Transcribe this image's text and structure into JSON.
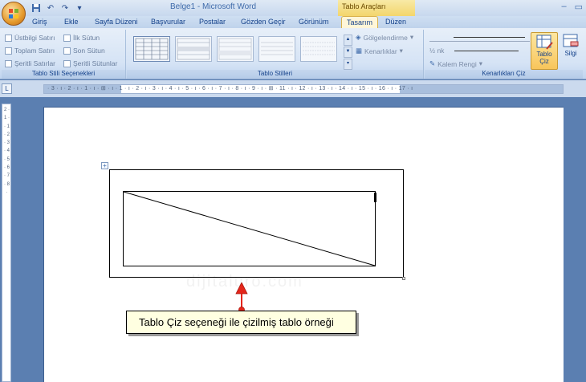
{
  "window": {
    "title": "Belge1 - Microsoft Word",
    "contextual_title": "Tablo Araçları",
    "minimize": "–",
    "restore": "▭"
  },
  "qat": {
    "save_icon": "save-icon",
    "undo_icon": "undo-icon",
    "redo_icon": "redo-icon",
    "customize_icon": "customize-icon"
  },
  "tabs": [
    {
      "label": "Giriş"
    },
    {
      "label": "Ekle"
    },
    {
      "label": "Sayfa Düzeni"
    },
    {
      "label": "Başvurular"
    },
    {
      "label": "Postalar"
    },
    {
      "label": "Gözden Geçir"
    },
    {
      "label": "Görünüm"
    },
    {
      "label": "Tasarım"
    },
    {
      "label": "Düzen"
    }
  ],
  "active_tab": "Tasarım",
  "style_options": {
    "label": "Tablo Stili Seçenekleri",
    "items": [
      {
        "label": "Üstbilgi Satırı"
      },
      {
        "label": "İlk Sütun"
      },
      {
        "label": "Toplam Satırı"
      },
      {
        "label": "Son Sütun"
      },
      {
        "label": "Şeritli Satırlar"
      },
      {
        "label": "Şeritli Sütunlar"
      }
    ]
  },
  "table_styles": {
    "label": "Tablo Stilleri",
    "shading": "Gölgelendirme",
    "borders": "Kenarlıklar"
  },
  "draw_borders": {
    "label": "Kenarlıkları Çiz",
    "pen_weight": "½ nk",
    "pen_color": "Kalem Rengi",
    "draw_table_line1": "Tablo",
    "draw_table_line2": "Çiz",
    "eraser": "Silgi"
  },
  "ruler": {
    "horizontal": "· 3 · ı · 2 · ı · 1 · ı · ⊞ · ı · 1 · ı · 2 · ı · 3 · ı · 4 · ı · 5 · ı · 6 · ı · 7 · ı · 8 · ı · 9 · ı · ⊞ · 11 · ı · 12 · ı · 13 · ı · 14 · ı · 15 · ı · 16 · ı · 17 · ı",
    "vertical": "2 · 1 · · 1 · 2 · 3 · 4 · 5 · 6 · 7 · 8 ·"
  },
  "document": {
    "watermark": "dijitaluro.com",
    "callout": "Tablo Çiz seçeneği ile çizilmiş tablo örneği"
  },
  "colors": {
    "accent": "#15428b",
    "active_tab": "#fff6d8",
    "arrow": "#e4261b"
  }
}
